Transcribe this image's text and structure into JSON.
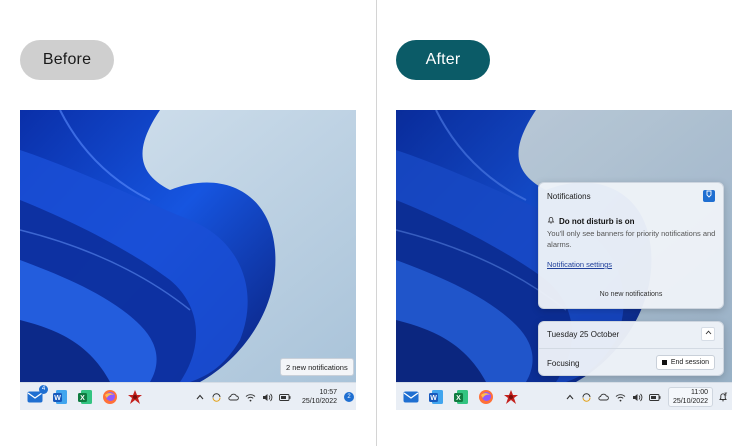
{
  "labels": {
    "before": "Before",
    "after": "After"
  },
  "before": {
    "toast": "2 new notifications",
    "clock": {
      "time": "10:57",
      "date": "25/10/2022"
    },
    "notification_count": "2",
    "mail_badge": "4"
  },
  "after": {
    "notifications_panel": {
      "title": "Notifications",
      "dnd_title": "Do not disturb is on",
      "dnd_description": "You'll only see banners for priority notifications and alarms.",
      "settings_link": "Notification settings",
      "empty_text": "No new notifications"
    },
    "calendar_panel": {
      "date": "Tuesday 25 October",
      "focus_label": "Focusing",
      "end_session_label": "End session"
    },
    "clock": {
      "time": "11:00",
      "date": "25/10/2022"
    }
  },
  "taskbar": {
    "apps": [
      "mail-icon",
      "word-icon",
      "excel-icon",
      "firefox-icon",
      "app-icon"
    ],
    "tray": [
      "chevron-up-icon",
      "sync-icon",
      "cloud-icon",
      "wifi-icon",
      "volume-icon",
      "battery-icon"
    ]
  },
  "colors": {
    "accent": "#0b5b67",
    "blue": "#1f6fd1"
  }
}
